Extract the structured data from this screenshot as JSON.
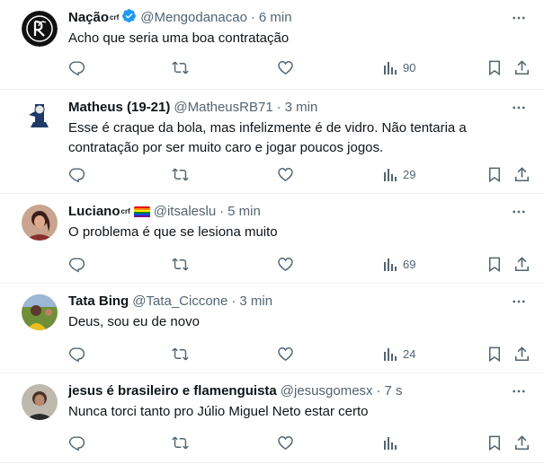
{
  "tweets": [
    {
      "name": "Nação",
      "name_sup": "crf",
      "verified": true,
      "flag": false,
      "handle": "@Mengodanacao",
      "time": "6 min",
      "text": "Acho que seria uma boa contratação",
      "views": "90",
      "avatar": "club-crest-avatar"
    },
    {
      "name": "Matheus (19-21)",
      "name_sup": "",
      "verified": false,
      "flag": false,
      "handle": "@MatheusRB71",
      "time": "3 min",
      "text": "Esse é craque da bola, mas infelizmente é de vidro. Não tentaria a contratação por ser muito caro e jogar poucos jogos.",
      "views": "29",
      "avatar": "profile-photo-avatar"
    },
    {
      "name": "Luciano",
      "name_sup": "crf",
      "verified": false,
      "flag": true,
      "handle": "@itsaleslu",
      "time": "5 min",
      "text": "O problema é que se lesiona muito",
      "views": "69",
      "avatar": "profile-photo-avatar"
    },
    {
      "name": "Tata Bing",
      "name_sup": "",
      "verified": false,
      "flag": false,
      "handle": "@Tata_Ciccone",
      "time": "3 min",
      "text": "Deus, sou eu de novo",
      "views": "24",
      "avatar": "profile-photo-avatar"
    },
    {
      "name": "jesus é brasileiro e flamenguista",
      "name_sup": "",
      "verified": false,
      "flag": false,
      "handle": "@jesusgomesx",
      "time": "7 s",
      "text": "Nunca torci tanto pro Júlio Miguel Neto estar certo",
      "views": "",
      "avatar": "profile-photo-avatar"
    }
  ],
  "icons": {
    "reply": "reply-icon",
    "repost": "repost-icon",
    "like": "like-icon",
    "views": "views-icon",
    "bookmark": "bookmark-icon",
    "share": "share-icon",
    "more": "more-options-icon",
    "verified": "verified-badge-icon",
    "flag": "rainbow-flag-icon"
  },
  "colors": {
    "text": "#0f1419",
    "secondary": "#536471",
    "divider": "#eff3f4",
    "verified": "#1d9bf0"
  }
}
